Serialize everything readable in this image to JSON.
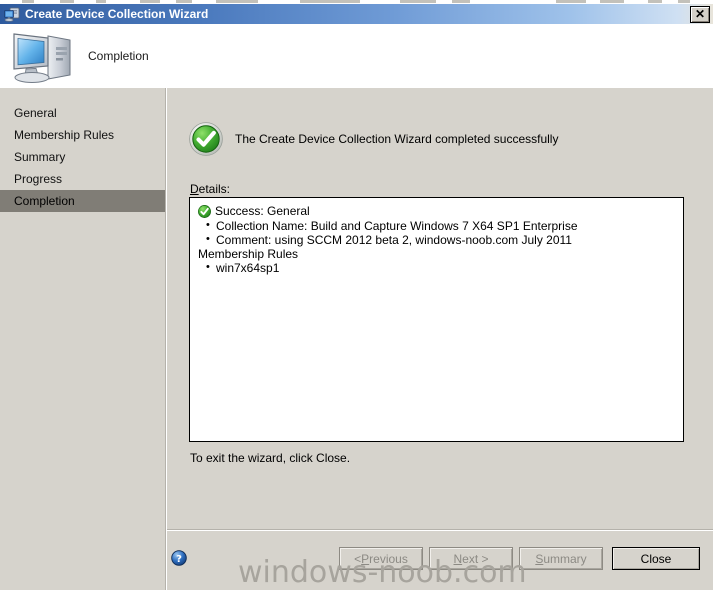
{
  "window": {
    "title": "Create Device Collection Wizard",
    "icon": "wizard-computer-icon",
    "close_label": "✕"
  },
  "header": {
    "title": "Completion",
    "icon": "computer-monitor-icon"
  },
  "sidebar": {
    "items": [
      {
        "label": "General",
        "active": false
      },
      {
        "label": "Membership Rules",
        "active": false
      },
      {
        "label": "Summary",
        "active": false
      },
      {
        "label": "Progress",
        "active": false
      },
      {
        "label": "Completion",
        "active": true
      }
    ]
  },
  "main": {
    "status_icon": "green-check-circle-icon",
    "status_text": "The Create Device Collection Wizard completed successfully",
    "details_label_accel": "D",
    "details_label_rest": "etails:",
    "details": {
      "result_icon": "green-check-small-icon",
      "result_line": "Success: General",
      "general_bullets": [
        "Collection Name: Build and Capture Windows 7 X64 SP1 Enterprise",
        "Comment: using SCCM 2012 beta 2, windows-noob.com July 2011"
      ],
      "rules_heading": "Membership Rules",
      "rules_bullets": [
        "win7x64sp1"
      ]
    },
    "exit_note": "To exit the wizard, click Close."
  },
  "footer": {
    "help_icon": "help-question-icon",
    "buttons": [
      {
        "name": "previous",
        "pre": "< ",
        "accel": "P",
        "post": "revious",
        "enabled": false
      },
      {
        "name": "next",
        "pre": "",
        "accel": "N",
        "post": "ext >",
        "enabled": false
      },
      {
        "name": "summary",
        "pre": "",
        "accel": "S",
        "post": "ummary",
        "enabled": false
      },
      {
        "name": "close",
        "pre": "",
        "accel": "",
        "post": "Close",
        "enabled": true
      }
    ]
  },
  "watermark": {
    "text": "windows-noob.com"
  },
  "colors": {
    "titlebar_start": "#2d5a9e",
    "titlebar_end": "#cfe0f3",
    "dialog_face": "#d6d3cc",
    "sidebar_active": "#807d76",
    "success_green": "#3da43d",
    "watermark_gray": "#a7a49d"
  }
}
